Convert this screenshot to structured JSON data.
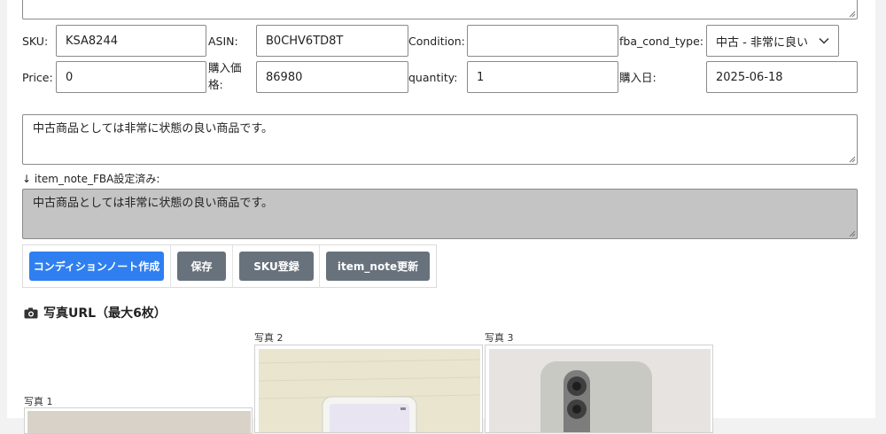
{
  "top_note": {
    "value": ""
  },
  "row1": {
    "sku_label": "SKU:",
    "sku_value": "KSA8244",
    "asin_label": "ASIN:",
    "asin_value": "B0CHV6TD8T",
    "condition_label": "Condition:",
    "condition_value": "",
    "fba_label": "fba_cond_type:",
    "fba_value": "中古 - 非常に良い"
  },
  "row2": {
    "price_label": "Price:",
    "price_value": "0",
    "purchase_price_label_1": "購入価",
    "purchase_price_label_2": "格:",
    "purchase_price_value": "86980",
    "quantity_label": "quantity:",
    "quantity_value": "1",
    "purchase_date_label": "購入日:",
    "purchase_date_value": "2025-06-18"
  },
  "note": {
    "value": "中古商品としては非常に状態の良い商品です。"
  },
  "fba_note": {
    "label": "↓ item_note_FBA設定済み:",
    "value": "中古商品としては非常に状態の良い商品です。"
  },
  "buttons": {
    "create_note": "コンディションノート作成",
    "save": "保存",
    "sku_register": "SKU登録",
    "update_note": "item_note更新"
  },
  "photos": {
    "title": "写真URL（最大6枚）",
    "items": [
      {
        "label": "写真 1"
      },
      {
        "label": "写真 2"
      },
      {
        "label": "写真 3"
      }
    ]
  },
  "colors": {
    "primary": "#2f7ff0",
    "secondary": "#68727c",
    "readonly_bg": "#c4c4c4"
  }
}
